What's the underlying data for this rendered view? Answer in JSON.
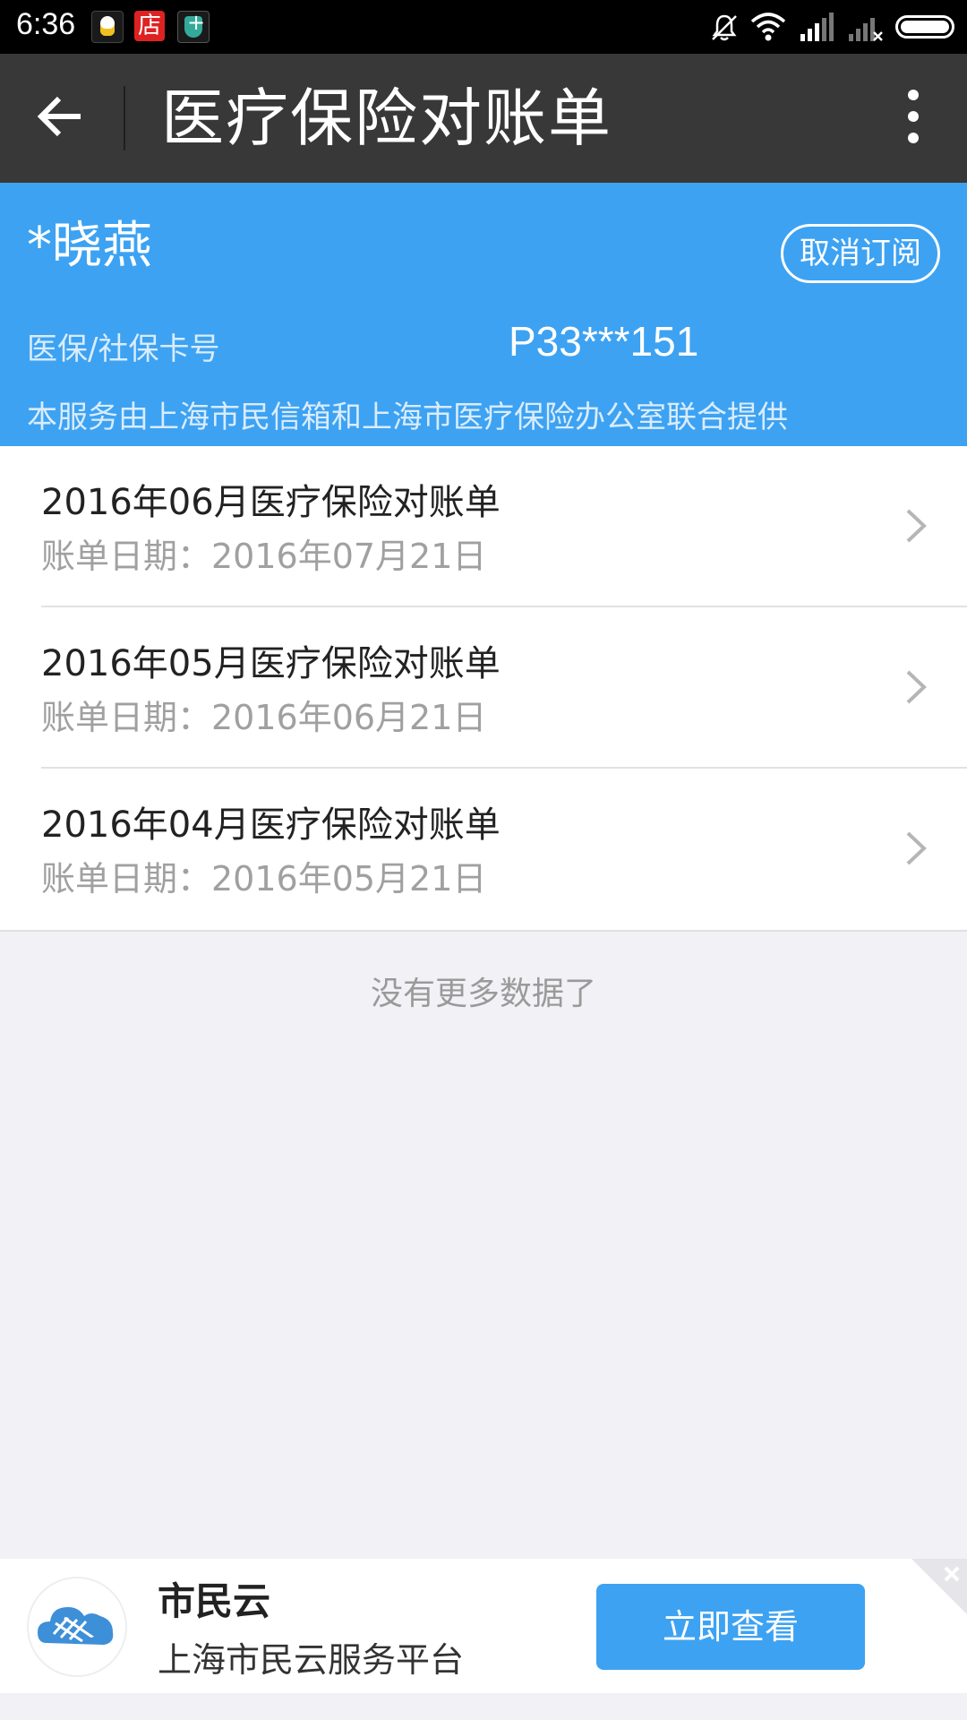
{
  "status_bar": {
    "time": "6:36",
    "store_icon_text": "店"
  },
  "titlebar": {
    "title": "医疗保险对账单"
  },
  "header": {
    "name": "*晓燕",
    "unsubscribe_label": "取消订阅",
    "card_label": "医保/社保卡号",
    "card_value": "P33***151",
    "provider_note": "本服务由上海市民信箱和上海市医疗保险办公室联合提供"
  },
  "statements": [
    {
      "title": "2016年06月医疗保险对账单",
      "date": "账单日期：2016年07月21日"
    },
    {
      "title": "2016年05月医疗保险对账单",
      "date": "账单日期：2016年06月21日"
    },
    {
      "title": "2016年04月医疗保险对账单",
      "date": "账单日期：2016年05月21日"
    }
  ],
  "no_more_text": "没有更多数据了",
  "banner": {
    "title": "市民云",
    "subtitle": "上海市民云服务平台",
    "button_label": "立即查看"
  },
  "colors": {
    "accent": "#3da2f2",
    "titlebar": "#383838"
  },
  "icons": [
    "back-arrow-icon",
    "more-vertical-icon",
    "chevron-right-icon",
    "close-icon",
    "app-logo-icon"
  ]
}
